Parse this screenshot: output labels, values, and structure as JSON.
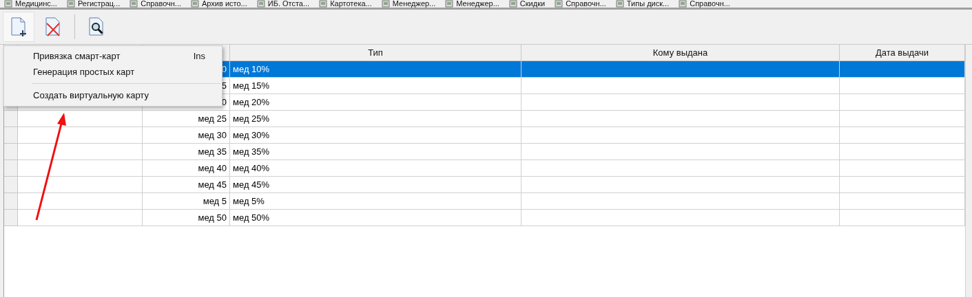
{
  "window_tabs": [
    {
      "label": "Медицинс..."
    },
    {
      "label": "Регистрац..."
    },
    {
      "label": "Справочн..."
    },
    {
      "label": "Архив исто..."
    },
    {
      "label": "ИБ. Отста..."
    },
    {
      "label": "Картотека..."
    },
    {
      "label": "Менеджер..."
    },
    {
      "label": "Менеджер..."
    },
    {
      "label": "Скидки"
    },
    {
      "label": "Справочн..."
    },
    {
      "label": "Типы диск..."
    },
    {
      "label": "Справочн..."
    }
  ],
  "toolbar": [
    {
      "kind": "new",
      "pressed": true
    },
    {
      "kind": "delete",
      "pressed": false
    },
    {
      "kind": "view",
      "pressed": false
    }
  ],
  "table": {
    "headers": [
      "Тип",
      "Кому выдана",
      "Дата выдачи"
    ],
    "rows": [
      {
        "selected": true,
        "column_2": "0",
        "type": "мед 10%"
      },
      {
        "selected": false,
        "column_2": "5",
        "type": "мед 15%"
      },
      {
        "selected": false,
        "column_2": "0",
        "type": "мед 20%"
      },
      {
        "selected": false,
        "column_2": "мед 25",
        "type": "мед 25%"
      },
      {
        "selected": false,
        "column_2": "мед 30",
        "type": "мед 30%"
      },
      {
        "selected": false,
        "column_2": "мед 35",
        "type": "мед 35%"
      },
      {
        "selected": false,
        "column_2": "мед 40",
        "type": "мед 40%"
      },
      {
        "selected": false,
        "column_2": "мед 45",
        "type": "мед 45%"
      },
      {
        "selected": false,
        "column_2": "мед 5",
        "type": "мед 5%"
      },
      {
        "selected": false,
        "column_2": "мед 50",
        "type": "мед 50%"
      }
    ]
  },
  "popup_menu": [
    {
      "kind": "item",
      "label": "Привязка смарт-карт",
      "shortcut": "Ins"
    },
    {
      "kind": "item",
      "label": "Генерация простых карт"
    },
    {
      "kind": "separator"
    },
    {
      "kind": "item",
      "label": "Создать виртуальную карту"
    }
  ]
}
